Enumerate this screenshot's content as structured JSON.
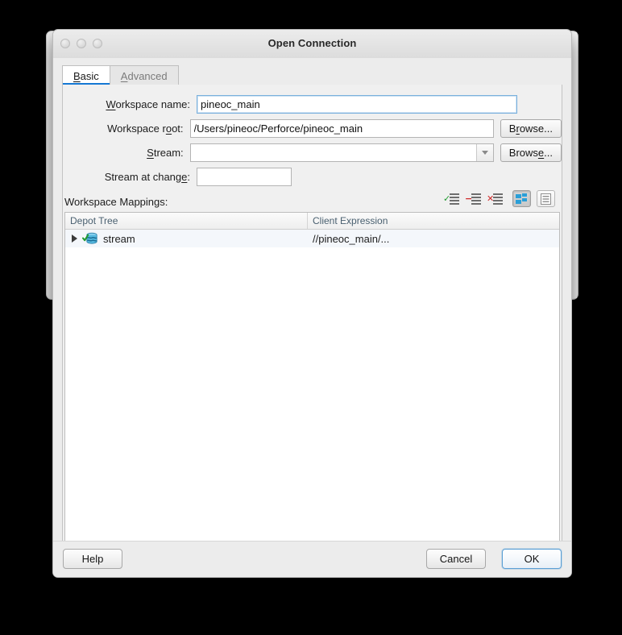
{
  "window": {
    "title": "Open Connection",
    "traffic_lights": [
      "close-button",
      "minimize-button",
      "zoom-button"
    ]
  },
  "tabs": [
    {
      "label": "Basic",
      "mnemonic": "B",
      "active": true
    },
    {
      "label": "Advanced",
      "mnemonic": "A",
      "active": false
    }
  ],
  "form": {
    "workspace_name": {
      "label_pre": "",
      "label_mn": "W",
      "label_post": "orkspace name:",
      "value": "pineoc_main",
      "placeholder": ""
    },
    "workspace_root": {
      "label_pre": "Workspace r",
      "label_mn": "o",
      "label_post": "ot:",
      "value": "/Users/pineoc/Perforce/pineoc_main",
      "placeholder": "",
      "browse_pre": "B",
      "browse_mn": "r",
      "browse_post": "owse..."
    },
    "stream": {
      "label_pre": "",
      "label_mn": "S",
      "label_post": "tream:",
      "value": "",
      "placeholder": "",
      "browse_pre": "Brows",
      "browse_mn": "e",
      "browse_post": "..."
    },
    "stream_at_change": {
      "label_pre": "Stream at chang",
      "label_mn": "e",
      "label_post": ":",
      "value": "",
      "placeholder": ""
    },
    "mappings_label": "Workspace Mappings:"
  },
  "map_toolbar": [
    {
      "name": "include-mapping-button",
      "glyph": "✓",
      "kind": "check"
    },
    {
      "name": "exclude-mapping-button",
      "glyph": "−",
      "kind": "minus"
    },
    {
      "name": "remove-mapping-button",
      "glyph": "✕",
      "kind": "cross"
    },
    {
      "name": "tree-view-button",
      "pressed": true
    },
    {
      "name": "list-view-button",
      "pressed": false
    }
  ],
  "table": {
    "columns": [
      "Depot Tree",
      "Client Expression"
    ],
    "rows": [
      {
        "depot_tree": "stream",
        "client_expression": "//pineoc_main/...",
        "expanded": false,
        "included": true
      }
    ]
  },
  "footer": {
    "help": "Help",
    "cancel": "Cancel",
    "ok": "OK"
  },
  "colors": {
    "accent": "#1578d3",
    "default_button_border": "#5a9fd4",
    "include_check": "#1f9b2f",
    "remove_red": "#cf2b2b",
    "depot_blue": "#2a9fd8",
    "header_text": "#4a6070",
    "window_bg": "#ececec",
    "field_bg": "#ffffff"
  }
}
